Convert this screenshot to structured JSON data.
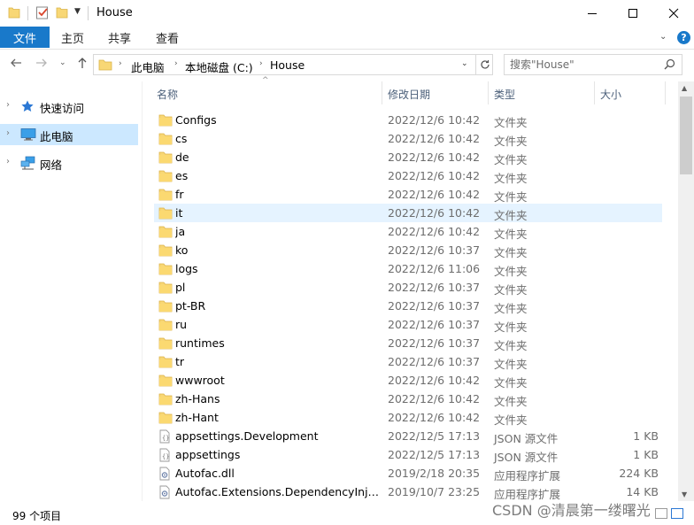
{
  "window": {
    "title": "House"
  },
  "ribbon": {
    "file_tab": "文件",
    "tabs": [
      "主页",
      "共享",
      "查看"
    ],
    "accent": "#1979ca"
  },
  "address": {
    "crumbs": [
      "此电脑",
      "本地磁盘 (C:)",
      "House"
    ]
  },
  "search": {
    "placeholder": "搜索\"House\""
  },
  "sidebar": {
    "items": [
      {
        "label": "快速访问",
        "icon": "star-icon"
      },
      {
        "label": "此电脑",
        "icon": "computer-icon",
        "selected": true
      },
      {
        "label": "网络",
        "icon": "network-icon"
      }
    ],
    "selected_color": "#cce8ff"
  },
  "columns": {
    "name": "名称",
    "date": "修改日期",
    "type": "类型",
    "size": "大小"
  },
  "files": [
    {
      "name": "Configs",
      "date": "2022/12/6 10:42",
      "type": "文件夹",
      "size": "",
      "icon": "folder-icon"
    },
    {
      "name": "cs",
      "date": "2022/12/6 10:42",
      "type": "文件夹",
      "size": "",
      "icon": "folder-icon"
    },
    {
      "name": "de",
      "date": "2022/12/6 10:42",
      "type": "文件夹",
      "size": "",
      "icon": "folder-icon"
    },
    {
      "name": "es",
      "date": "2022/12/6 10:42",
      "type": "文件夹",
      "size": "",
      "icon": "folder-icon"
    },
    {
      "name": "fr",
      "date": "2022/12/6 10:42",
      "type": "文件夹",
      "size": "",
      "icon": "folder-icon"
    },
    {
      "name": "it",
      "date": "2022/12/6 10:42",
      "type": "文件夹",
      "size": "",
      "icon": "folder-icon",
      "hover": true
    },
    {
      "name": "ja",
      "date": "2022/12/6 10:42",
      "type": "文件夹",
      "size": "",
      "icon": "folder-icon"
    },
    {
      "name": "ko",
      "date": "2022/12/6 10:37",
      "type": "文件夹",
      "size": "",
      "icon": "folder-icon"
    },
    {
      "name": "logs",
      "date": "2022/12/6 11:06",
      "type": "文件夹",
      "size": "",
      "icon": "folder-icon"
    },
    {
      "name": "pl",
      "date": "2022/12/6 10:37",
      "type": "文件夹",
      "size": "",
      "icon": "folder-icon"
    },
    {
      "name": "pt-BR",
      "date": "2022/12/6 10:37",
      "type": "文件夹",
      "size": "",
      "icon": "folder-icon"
    },
    {
      "name": "ru",
      "date": "2022/12/6 10:37",
      "type": "文件夹",
      "size": "",
      "icon": "folder-icon"
    },
    {
      "name": "runtimes",
      "date": "2022/12/6 10:37",
      "type": "文件夹",
      "size": "",
      "icon": "folder-icon"
    },
    {
      "name": "tr",
      "date": "2022/12/6 10:37",
      "type": "文件夹",
      "size": "",
      "icon": "folder-icon"
    },
    {
      "name": "wwwroot",
      "date": "2022/12/6 10:42",
      "type": "文件夹",
      "size": "",
      "icon": "folder-icon"
    },
    {
      "name": "zh-Hans",
      "date": "2022/12/6 10:42",
      "type": "文件夹",
      "size": "",
      "icon": "folder-icon"
    },
    {
      "name": "zh-Hant",
      "date": "2022/12/6 10:42",
      "type": "文件夹",
      "size": "",
      "icon": "folder-icon"
    },
    {
      "name": "appsettings.Development",
      "date": "2022/12/5 17:13",
      "type": "JSON 源文件",
      "size": "1 KB",
      "icon": "json-file-icon"
    },
    {
      "name": "appsettings",
      "date": "2022/12/5 17:13",
      "type": "JSON 源文件",
      "size": "1 KB",
      "icon": "json-file-icon"
    },
    {
      "name": "Autofac.dll",
      "date": "2019/2/18 20:35",
      "type": "应用程序扩展",
      "size": "224 KB",
      "icon": "dll-file-icon"
    },
    {
      "name": "Autofac.Extensions.DependencyInjecti...",
      "date": "2019/10/7 23:25",
      "type": "应用程序扩展",
      "size": "14 KB",
      "icon": "dll-file-icon"
    }
  ],
  "status": {
    "item_count": "99 个项目"
  },
  "watermark": "CSDN @清晨第一缕曙光"
}
